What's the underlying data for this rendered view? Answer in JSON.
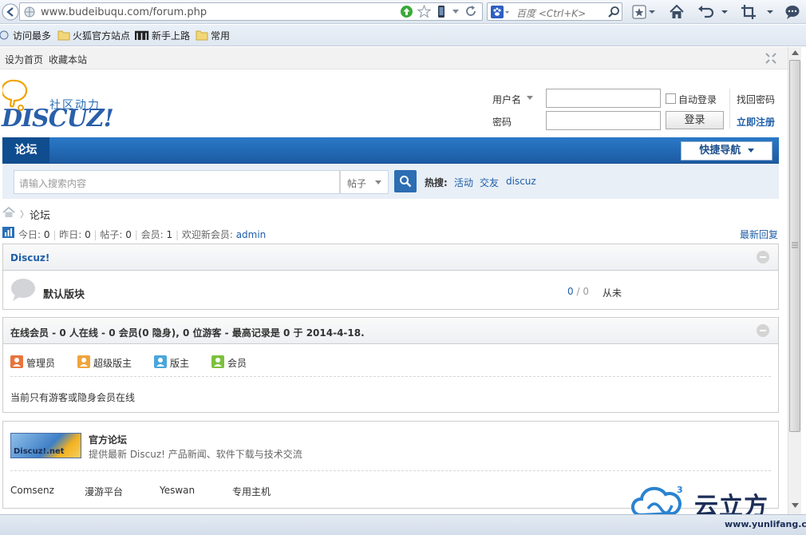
{
  "browser": {
    "url": "www.budeibuqu.com/forum.php",
    "search_placeholder": "百度 <Ctrl+K>",
    "bookmarks": [
      "访问最多",
      "火狐官方站点",
      "新手上路",
      "常用"
    ]
  },
  "topbar": {
    "set_home": "设为首页",
    "bookmark": "收藏本站"
  },
  "logo": {
    "tagline": "社区动力",
    "wordmark": "DISCUZ!"
  },
  "login": {
    "username_label": "用户名",
    "password_label": "密码",
    "auto_login": "自动登录",
    "find_password": "找回密码",
    "login_button": "登录",
    "register": "立即注册"
  },
  "nav": {
    "forum": "论坛",
    "quick_nav": "快捷导航"
  },
  "search": {
    "placeholder": "请输入搜索内容",
    "type": "帖子",
    "hot_label": "热搜:",
    "hot_terms": [
      "活动",
      "交友",
      "discuz"
    ]
  },
  "breadcrumb": {
    "current": "论坛"
  },
  "stats": {
    "today_label": "今日:",
    "today": "0",
    "yesterday_label": "昨日:",
    "yesterday": "0",
    "posts_label": "帖子:",
    "posts": "0",
    "members_label": "会员:",
    "members": "1",
    "welcome_label": "欢迎新会员:",
    "newest_member": "admin",
    "latest_reply": "最新回复"
  },
  "category": {
    "title": "Discuz!",
    "forum_name": "默认版块",
    "threads": "0",
    "sep": "/",
    "posts": "0",
    "last_post": "从未"
  },
  "online": {
    "title": "在线会员 - 0 人在线 - 0 会员(0 隐身), 0 位游客 - 最高记录是 0 于 2014-4-18.",
    "legend": [
      "管理员",
      "超级版主",
      "版主",
      "会员"
    ],
    "legend_colors": [
      "#e8743c",
      "#f0a43c",
      "#4aa6dc",
      "#7cc13f"
    ],
    "empty_text": "当前只有游客或隐身会员在线"
  },
  "links": {
    "banner_text": "Discuz!.net",
    "title": "官方论坛",
    "description": "提供最新 Discuz! 产品新闻、软件下载与技术交流",
    "items": [
      "Comsenz",
      "漫游平台",
      "Yeswan",
      "专用主机"
    ]
  },
  "watermark": {
    "brand": "云立方",
    "url": "www.yunlifang.cn",
    "badge": "3"
  }
}
